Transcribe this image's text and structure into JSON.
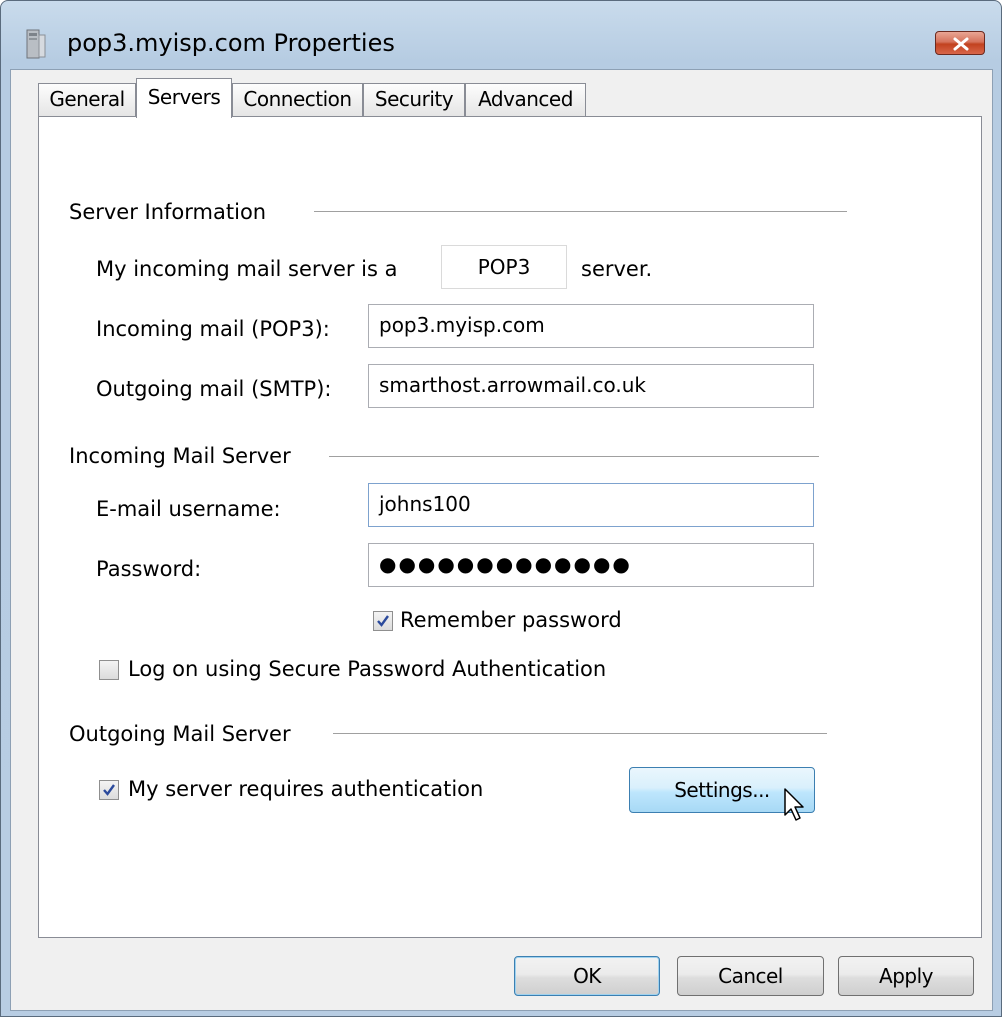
{
  "window": {
    "title": "pop3.myisp.com Properties",
    "close_icon": "close-icon"
  },
  "tabs": [
    {
      "label": "General",
      "active": false
    },
    {
      "label": "Servers",
      "active": true
    },
    {
      "label": "Connection",
      "active": false
    },
    {
      "label": "Security",
      "active": false
    },
    {
      "label": "Advanced",
      "active": false
    }
  ],
  "server_info": {
    "heading": "Server Information",
    "incoming_type_prefix": "My incoming mail server is a",
    "incoming_type_value": "POP3",
    "incoming_type_suffix": "server.",
    "incoming_label": "Incoming mail (POP3):",
    "incoming_value": "pop3.myisp.com",
    "outgoing_label": "Outgoing mail (SMTP):",
    "outgoing_value": "smarthost.arrowmail.co.uk"
  },
  "incoming_server": {
    "heading": "Incoming Mail Server",
    "username_label": "E-mail username:",
    "username_value": "johns100",
    "password_label": "Password:",
    "password_value": "●●●●●●●●●●●●●",
    "remember_label": "Remember password",
    "remember_checked": true,
    "spa_label": "Log on using Secure Password Authentication",
    "spa_checked": false
  },
  "outgoing_server": {
    "heading": "Outgoing Mail Server",
    "auth_label": "My server requires authentication",
    "auth_checked": true,
    "settings_label": "Settings..."
  },
  "footer": {
    "ok_label": "OK",
    "cancel_label": "Cancel",
    "apply_label": "Apply"
  },
  "colors": {
    "accent_border": "#3c7fb1",
    "title_gradient_top": "#c9dbec",
    "close_red": "#c2421f"
  }
}
